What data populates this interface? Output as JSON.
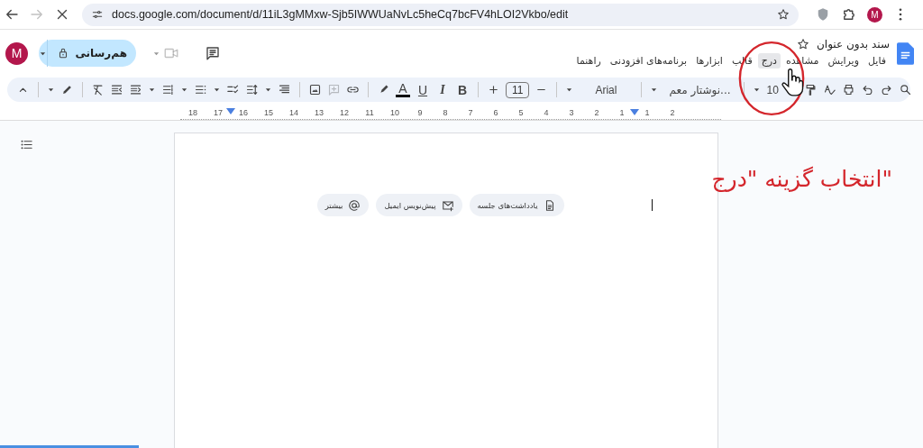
{
  "browser": {
    "url": "docs.google.com/document/d/11iL3gMMxw-Sjb5IWWUaNvLc5heCq7bcFV4hLOI2Vkbo/edit",
    "avatar": "M"
  },
  "account": {
    "avatar": "M"
  },
  "share_button": {
    "label": "هم‌رسانی"
  },
  "document": {
    "title": "سند بدون عنوان"
  },
  "menus": [
    {
      "label": "فایل",
      "selected": false
    },
    {
      "label": "ویرایش",
      "selected": false
    },
    {
      "label": "مشاهده",
      "selected": false
    },
    {
      "label": "درج",
      "selected": true
    },
    {
      "label": "قالب",
      "selected": false
    },
    {
      "label": "ابزارها",
      "selected": false
    },
    {
      "label": "برنامه‌های افزودنی",
      "selected": false
    },
    {
      "label": "راهنما",
      "selected": false
    }
  ],
  "toolbar": {
    "zoom": "10",
    "style": "نوشتار معم...",
    "font": "Arial",
    "font_size": "11",
    "bold": "B",
    "italic": "I",
    "underline": "U",
    "text_color": "A"
  },
  "ruler": {
    "left_labels": [
      "1",
      "2",
      "3",
      "4",
      "5",
      "6",
      "7",
      "8",
      "9",
      "10",
      "11",
      "12",
      "13",
      "14",
      "15",
      "16",
      "17",
      "18"
    ],
    "right_labels": [
      "2",
      "1"
    ]
  },
  "smart_chips": [
    {
      "label": "یادداشت‌های جلسه",
      "kind": "notes"
    },
    {
      "label": "پیش‌نویس ایمیل",
      "kind": "email"
    },
    {
      "label": "بیشتر",
      "kind": "more"
    }
  ],
  "annotation": {
    "text": "انتخاب گزینه \"درج\""
  },
  "loading": {
    "level": 0.15
  }
}
